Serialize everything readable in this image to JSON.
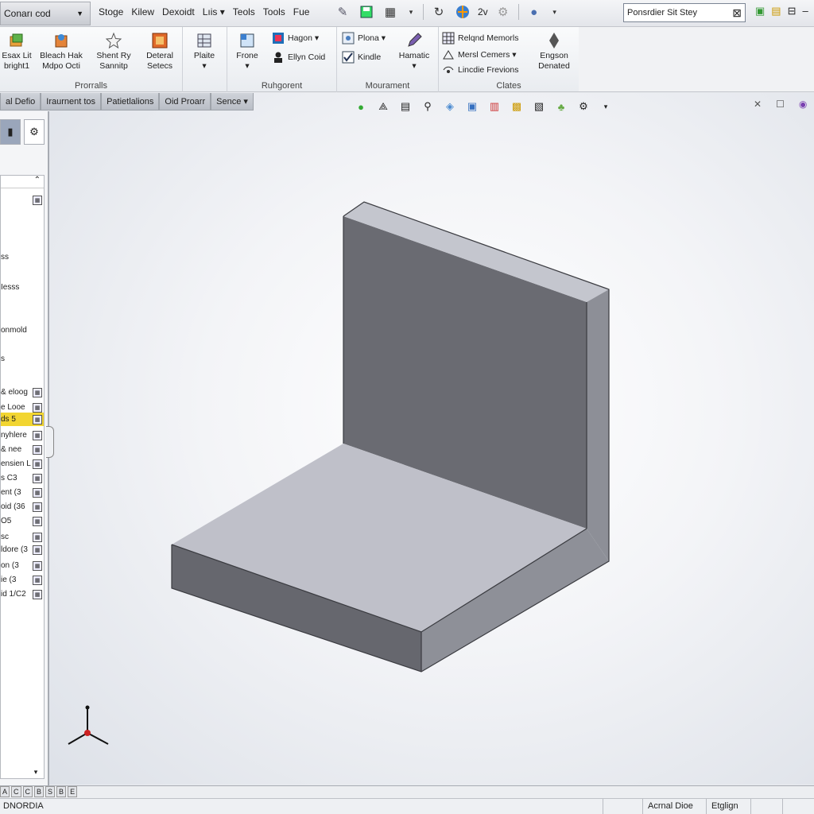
{
  "titlebar": {
    "app_button": "Conarı cod",
    "menus": [
      "Stoge",
      "Kilew",
      "Dexoidt",
      "Lıis ▾",
      "Teols",
      "Tools",
      "Fue"
    ],
    "zoom_text": "2v",
    "search_placeholder": "Ponsrdier Sit Stey"
  },
  "ribbon": {
    "groups": [
      {
        "title": "Prorralls",
        "buttons": [
          {
            "line1": "Esax Lit",
            "line2": "bright1",
            "icon": "extrude-icon"
          },
          {
            "line1": "Bleach Hak",
            "line2": "Mdpo Octi",
            "icon": "revolve-icon"
          },
          {
            "line1": "Shent Ry",
            "line2": "Sannitp",
            "icon": "star-icon"
          },
          {
            "line1": "Deteral",
            "line2": "Setecs",
            "icon": "feature-icon"
          }
        ]
      },
      {
        "title": "",
        "buttons": [
          {
            "line1": "Plaite",
            "line2": "",
            "icon": "plate-icon"
          }
        ]
      },
      {
        "title": "Ruhgorent",
        "big": {
          "line1": "Frone",
          "line2": "",
          "icon": "frame-icon"
        },
        "small": [
          {
            "label": "Hagon ▾",
            "icon": "hexagon-icon"
          },
          {
            "label": "Ellyn Coid",
            "icon": "person-icon"
          }
        ]
      },
      {
        "title": "Mourament",
        "small": [
          {
            "label": "Plona ▾",
            "icon": "plane-icon"
          },
          {
            "label": "Kindle",
            "icon": "check-icon"
          }
        ],
        "big": {
          "line1": "Hamatic",
          "line2": "",
          "icon": "pencil-icon"
        }
      },
      {
        "title": "Clates",
        "small": [
          {
            "label": "Relqnd Memorls",
            "icon": "grid-icon"
          },
          {
            "label": "Mersl Cemers ▾",
            "icon": "mirror-icon"
          },
          {
            "label": "Lincdie Frevions",
            "icon": "link-icon"
          }
        ],
        "big": {
          "line1": "Engson",
          "line2": "Denated",
          "icon": "diamond-icon"
        }
      }
    ]
  },
  "tabs": [
    "al Defio",
    "Iraurnent tos",
    "Patietlalions",
    "Oid Proarr",
    "Sence ▾"
  ],
  "feature_tree": {
    "rows": [
      {
        "text": "ss",
        "hl": false
      },
      {
        "text": "Iesss",
        "hl": false
      },
      {
        "text": "onmold",
        "hl": false
      },
      {
        "text": "s",
        "hl": false
      },
      {
        "text": "eloog &",
        "hl": false
      },
      {
        "text": "e Looe",
        "hl": false
      },
      {
        "text": "ds 5",
        "hl": true
      },
      {
        "text": "nyhlere",
        "hl": false
      },
      {
        "text": "nee &",
        "hl": false
      },
      {
        "text": "ensien L",
        "hl": false
      },
      {
        "text": "s C3",
        "hl": false
      },
      {
        "text": "ent (3",
        "hl": false
      },
      {
        "text": "oid (36",
        "hl": false
      },
      {
        "text": "O5",
        "hl": false
      },
      {
        "text": "sc",
        "hl": false
      },
      {
        "text": "ldore (3",
        "hl": false
      },
      {
        "text": "on (3",
        "hl": false
      },
      {
        "text": "ie (3",
        "hl": false
      },
      {
        "text": "id 1/C2",
        "hl": false
      }
    ]
  },
  "status": {
    "left": "DNORDIA",
    "cells": [
      "Acrnal Dioe",
      "Etglign"
    ],
    "mini": [
      "A",
      "C",
      "C",
      "B",
      "S",
      "B",
      "E"
    ]
  },
  "colors": {
    "accent_yellow": "#f2d531",
    "model_front": "#6a6b72",
    "model_top": "#c4c6ce"
  }
}
